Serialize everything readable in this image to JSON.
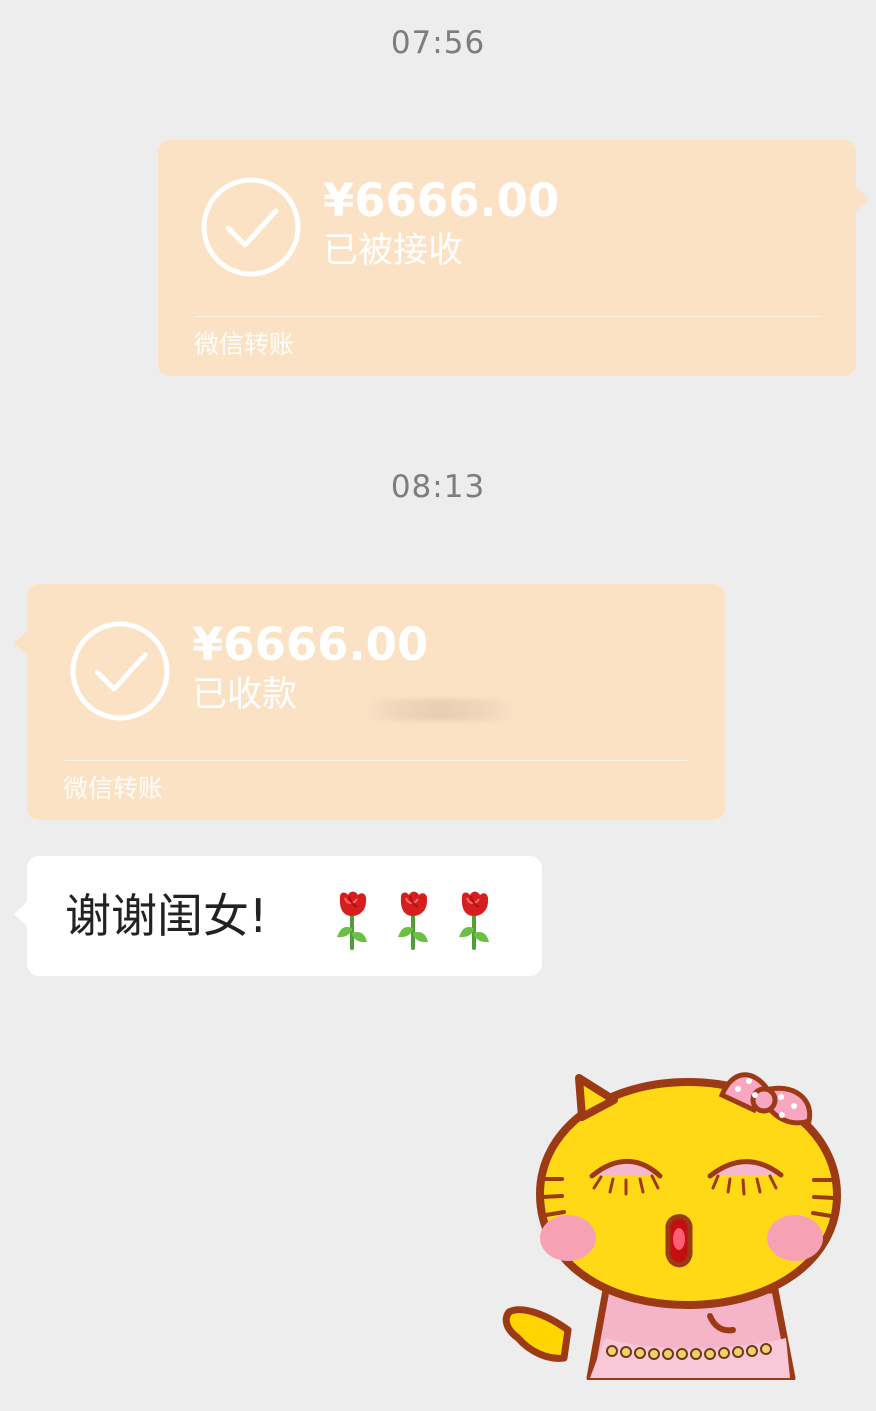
{
  "chat": {
    "time_1": "07:56",
    "time_2": "08:13",
    "transfer_sent": {
      "amount": "¥6666.00",
      "status": "已被接收",
      "label": "微信转账"
    },
    "transfer_received": {
      "amount": "¥6666.00",
      "status": "已收款",
      "label": "微信转账"
    },
    "message": {
      "text": "谢谢闺女!"
    }
  },
  "colors": {
    "background": "#ededed",
    "transfer_card": "#fbe2c4",
    "text_bubble": "#ffffff",
    "timestamp": "#7d7d7d"
  },
  "icons": {
    "check": "check-circle-icon",
    "rose": "rose-emoji-icon",
    "sticker": "cat-sticker"
  }
}
